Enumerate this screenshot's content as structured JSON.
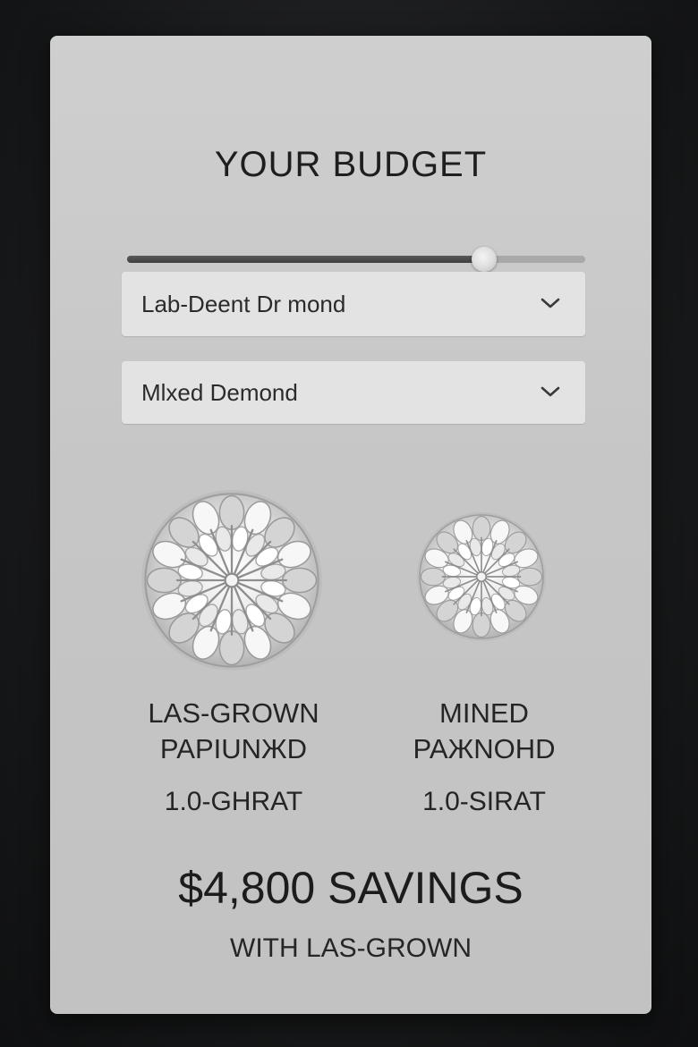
{
  "title": "YOUR BUDGET",
  "budget_slider": {
    "level": 0.78
  },
  "diamond_type_select": {
    "value": "Lab-Deent Dr mond"
  },
  "mined_select": {
    "value": "Mlxed Demond"
  },
  "lab_grown": {
    "line1": "LAS-GROWN",
    "line2": "PAPIUNЖD",
    "carat": "1.0-GHRAT"
  },
  "mined": {
    "line1": "MINED",
    "line2": "PAЖNOHD",
    "carat": "1.0-SIRAT"
  },
  "savings": {
    "amount": "$4,800 SAVINGS",
    "subtitle": "WITH LAS-GROWN"
  },
  "icons": {
    "dropdown": "chevron-down-icon",
    "diamond": "diamond-icon"
  },
  "colors": {
    "card": "#c8c8c8",
    "select_bg": "#e3e3e3",
    "text": "#1e1e1e"
  }
}
